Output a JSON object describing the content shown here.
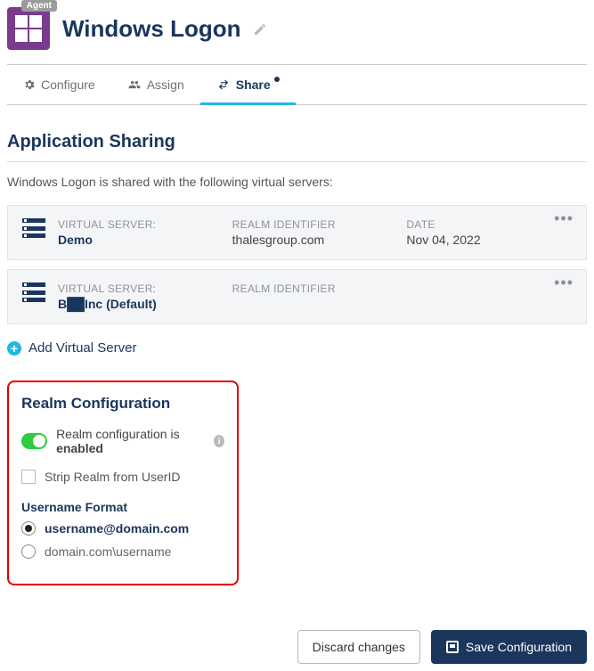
{
  "header": {
    "badge": "Agent",
    "title": "Windows Logon"
  },
  "tabs": {
    "configure": "Configure",
    "assign": "Assign",
    "share": "Share"
  },
  "sharing": {
    "title": "Application Sharing",
    "intro": "Windows Logon is shared with the following virtual servers:",
    "col_labels": {
      "virtual_server": "VIRTUAL SERVER:",
      "realm_identifier": "REALM IDENTIFIER",
      "date": "DATE"
    },
    "servers": [
      {
        "name": "Demo",
        "realm": "thalesgroup.com",
        "date": "Nov 04, 2022"
      },
      {
        "name": "B██Inc (Default)",
        "realm": "",
        "date": ""
      }
    ],
    "add_link": "Add Virtual Server"
  },
  "realm": {
    "title": "Realm Configuration",
    "toggle_text_prefix": "Realm configuration is ",
    "toggle_text_state": "enabled",
    "strip_label": "Strip Realm from UserID",
    "format_label": "Username Format",
    "options": {
      "opt1": "username@domain.com",
      "opt2": "domain.com\\username"
    }
  },
  "footer": {
    "discard": "Discard changes",
    "save": "Save Configuration"
  }
}
